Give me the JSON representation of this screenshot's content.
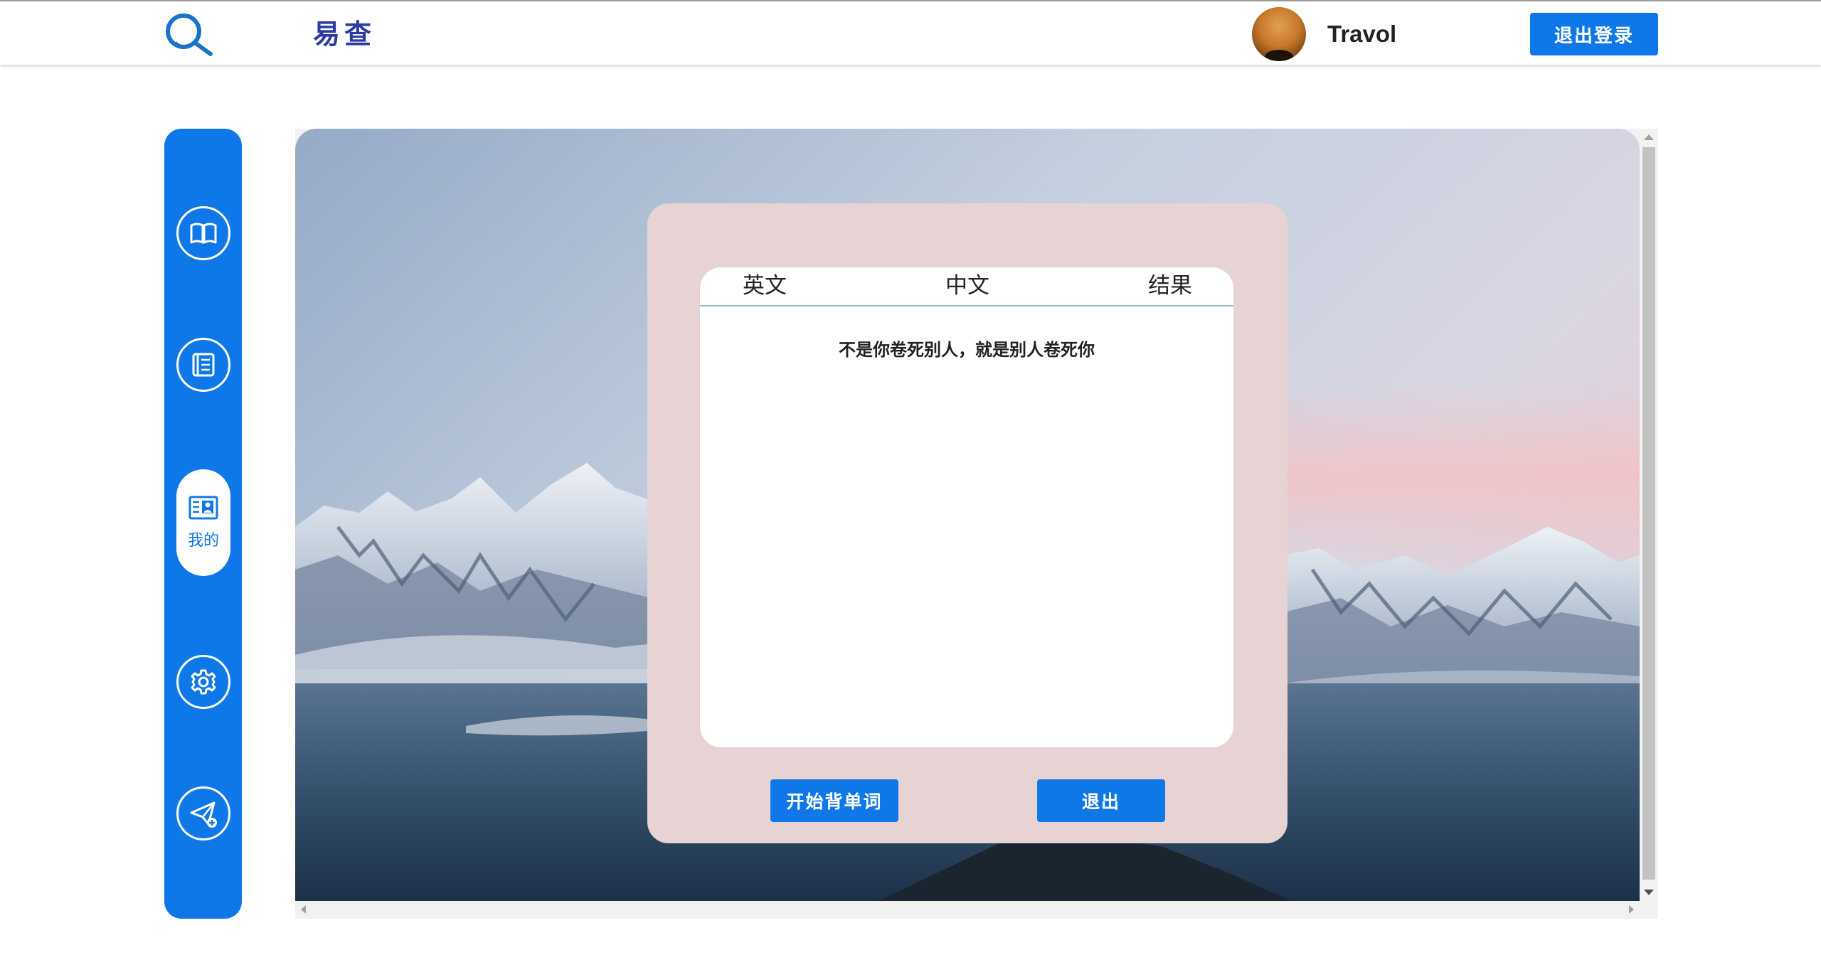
{
  "header": {
    "app_title": "易查",
    "username": "Travol",
    "logout_label": "退出登录"
  },
  "sidebar": {
    "items": [
      {
        "icon": "book-icon",
        "active": false
      },
      {
        "icon": "notebook-icon",
        "active": false
      },
      {
        "icon": "profile-card-icon",
        "active": true,
        "label": "我的"
      },
      {
        "icon": "gear-icon",
        "active": false
      },
      {
        "icon": "send-add-icon",
        "active": false
      }
    ]
  },
  "card": {
    "columns": [
      "英文",
      "中文",
      "结果"
    ],
    "message": "不是你卷死别人，就是别人卷死你",
    "start_button": "开始背单词",
    "exit_button": "退出"
  },
  "colors": {
    "accent": "#0f78e8",
    "title": "#2c3aa8",
    "card_bg": "#e7d3d3"
  }
}
